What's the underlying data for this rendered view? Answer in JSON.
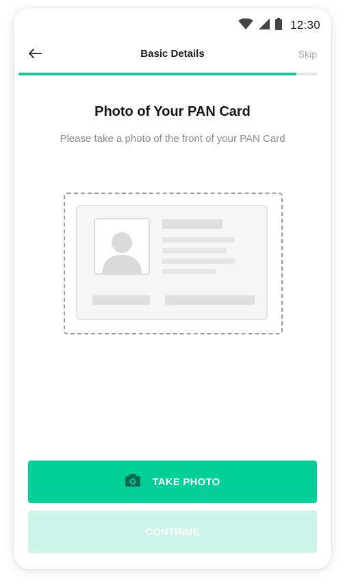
{
  "status_bar": {
    "time": "12:30",
    "icons": [
      "wifi-icon",
      "cellular-signal-icon",
      "battery-icon"
    ]
  },
  "app_bar": {
    "back_icon": "arrow-left-icon",
    "title": "Basic Details",
    "skip_label": "Skip"
  },
  "progress": {
    "fraction": 0.93
  },
  "content": {
    "heading": "Photo of Your PAN Card",
    "subtitle": "Please take a photo of the front of your PAN Card"
  },
  "illustration": {
    "name": "id-card-placeholder"
  },
  "actions": {
    "take_photo_label": "TAKE PHOTO",
    "take_photo_icon": "camera-icon",
    "continue_label": "CONTINUE",
    "continue_enabled": false
  },
  "colors": {
    "accent": "#00cf98",
    "progress": "#17c595",
    "accent_disabled": "#ccf4e8",
    "muted_text": "#8c8c8c",
    "skip_text": "#a9a9a9"
  }
}
